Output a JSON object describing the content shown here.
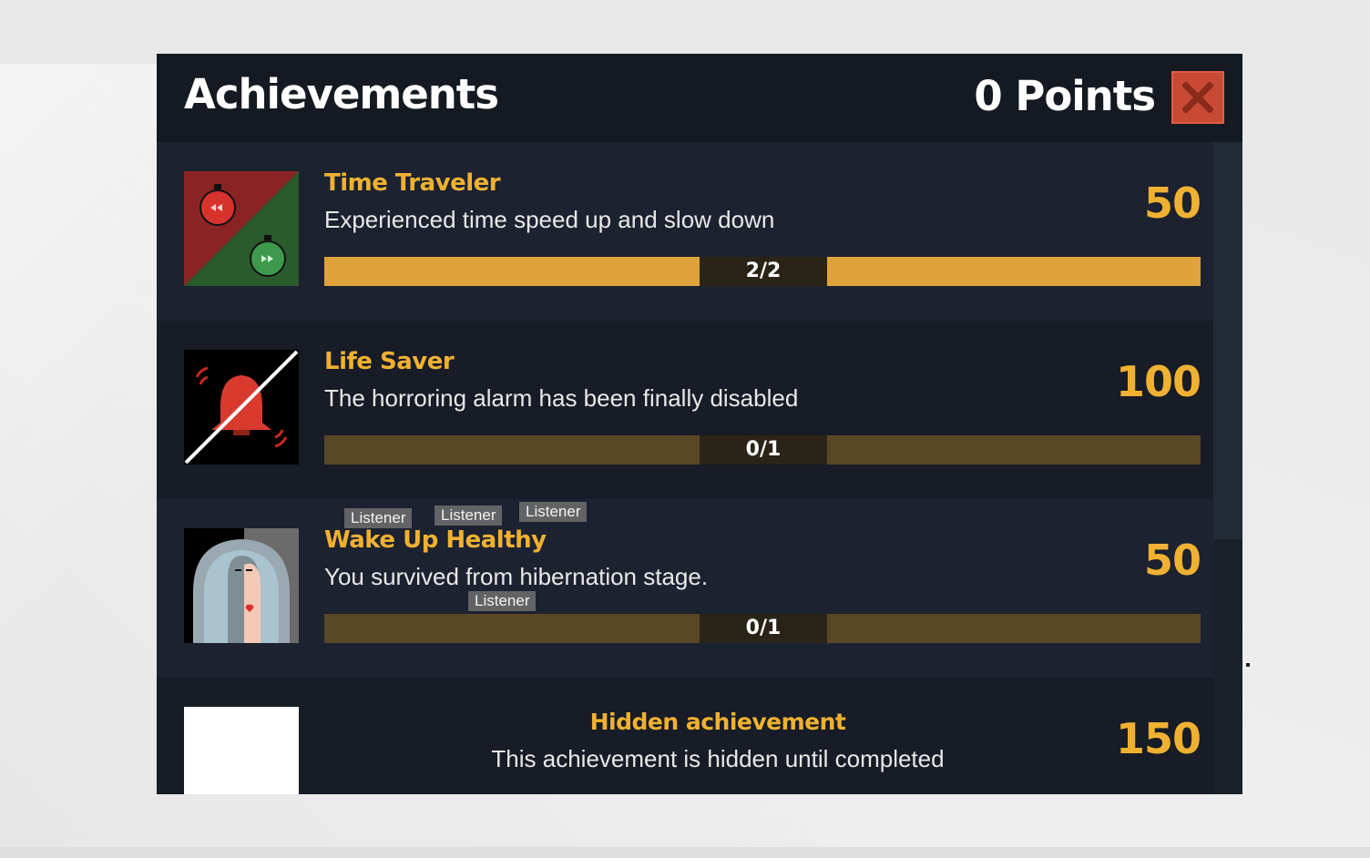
{
  "window": {
    "title": "Achievements",
    "points_label": "0 Points",
    "close_icon": "close-x-icon"
  },
  "colors": {
    "panel_bg": "#151a22",
    "accent": "#f0b132",
    "progress_fill": "#e0a23a",
    "progress_track": "#5a4726",
    "close_button": "#c84a34"
  },
  "achievements": [
    {
      "name": "Time Traveler",
      "description": "Experienced time speed up and slow down",
      "points": "50",
      "progress_label": "2/2",
      "progress_fraction": 1.0,
      "icon": "stopwatch-rewind-fastforward-icon"
    },
    {
      "name": "Life Saver",
      "description": "The horroring alarm has been finally disabled",
      "points": "100",
      "progress_label": "0/1",
      "progress_fraction": 0.0,
      "icon": "alarm-bell-muted-icon"
    },
    {
      "name": "Wake Up Healthy",
      "description": "You survived from hibernation stage.",
      "points": "50",
      "progress_label": "0/1",
      "progress_fraction": 0.0,
      "icon": "hibernation-pod-person-icon"
    },
    {
      "name": "Hidden achievement",
      "description": "This achievement is hidden until completed",
      "points": "150",
      "icon": "hidden-placeholder-icon"
    }
  ],
  "debug_tooltips": [
    "Listener",
    "Listener",
    "Listener",
    "Listener"
  ]
}
